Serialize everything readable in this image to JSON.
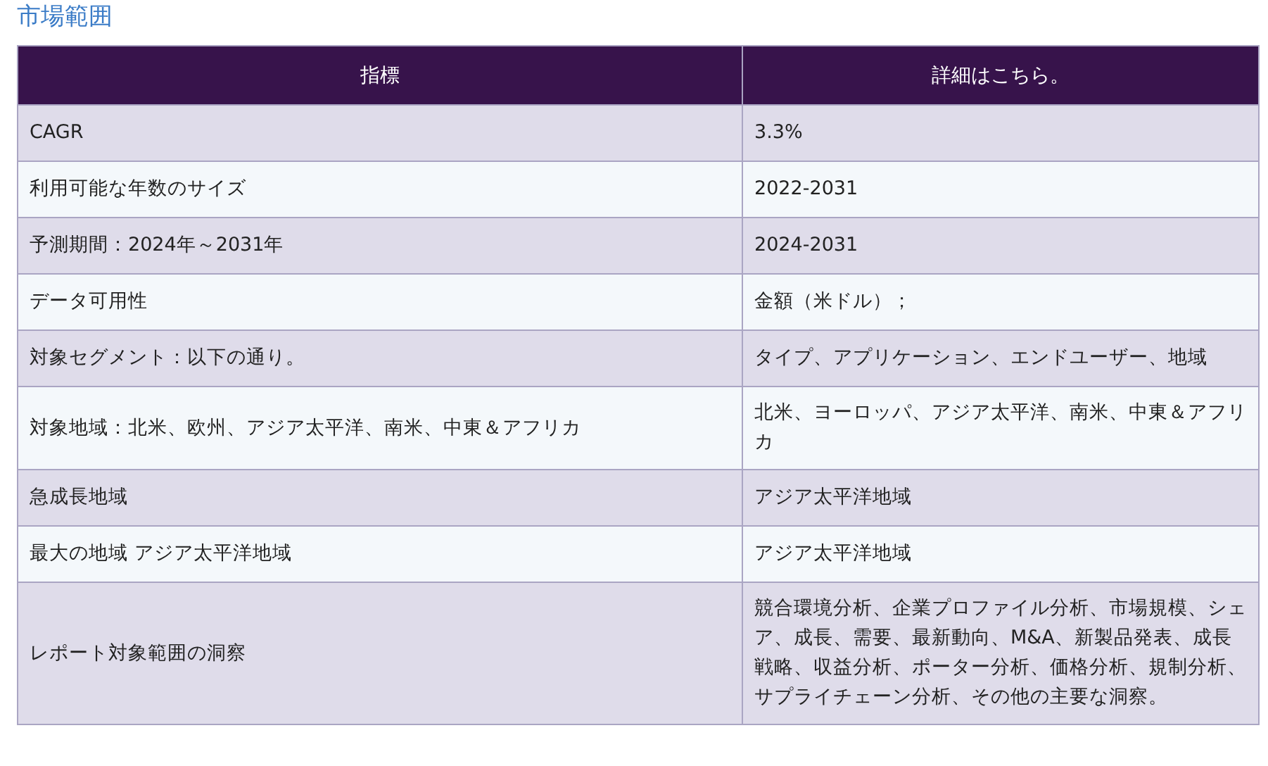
{
  "title": "市場範囲",
  "table": {
    "columns": [
      "指標",
      "詳細はこちら。"
    ],
    "rows": [
      [
        "CAGR",
        "3.3%"
      ],
      [
        "利用可能な年数のサイズ",
        "2022-2031"
      ],
      [
        "予測期間：2024年～2031年",
        "2024-2031"
      ],
      [
        "データ可用性",
        "金額（米ドル）；"
      ],
      [
        "対象セグメント：以下の通り。",
        "タイプ、アプリケーション、エンドユーザー、地域"
      ],
      [
        "対象地域：北米、欧州、アジア太平洋、南米、中東＆アフリカ",
        "北米、ヨーロッパ、アジア太平洋、南米、中東＆アフリカ"
      ],
      [
        "急成長地域",
        "アジア太平洋地域"
      ],
      [
        "最大の地域 アジア太平洋地域",
        "アジア太平洋地域"
      ],
      [
        "レポート対象範囲の洞察",
        "競合環境分析、企業プロファイル分析、市場規模、シェア、成長、需要、最新動向、M&A、新製品発表、成長戦略、収益分析、ポーター分析、価格分析、規制分析、サプライチェーン分析、その他の主要な洞察。"
      ]
    ]
  }
}
